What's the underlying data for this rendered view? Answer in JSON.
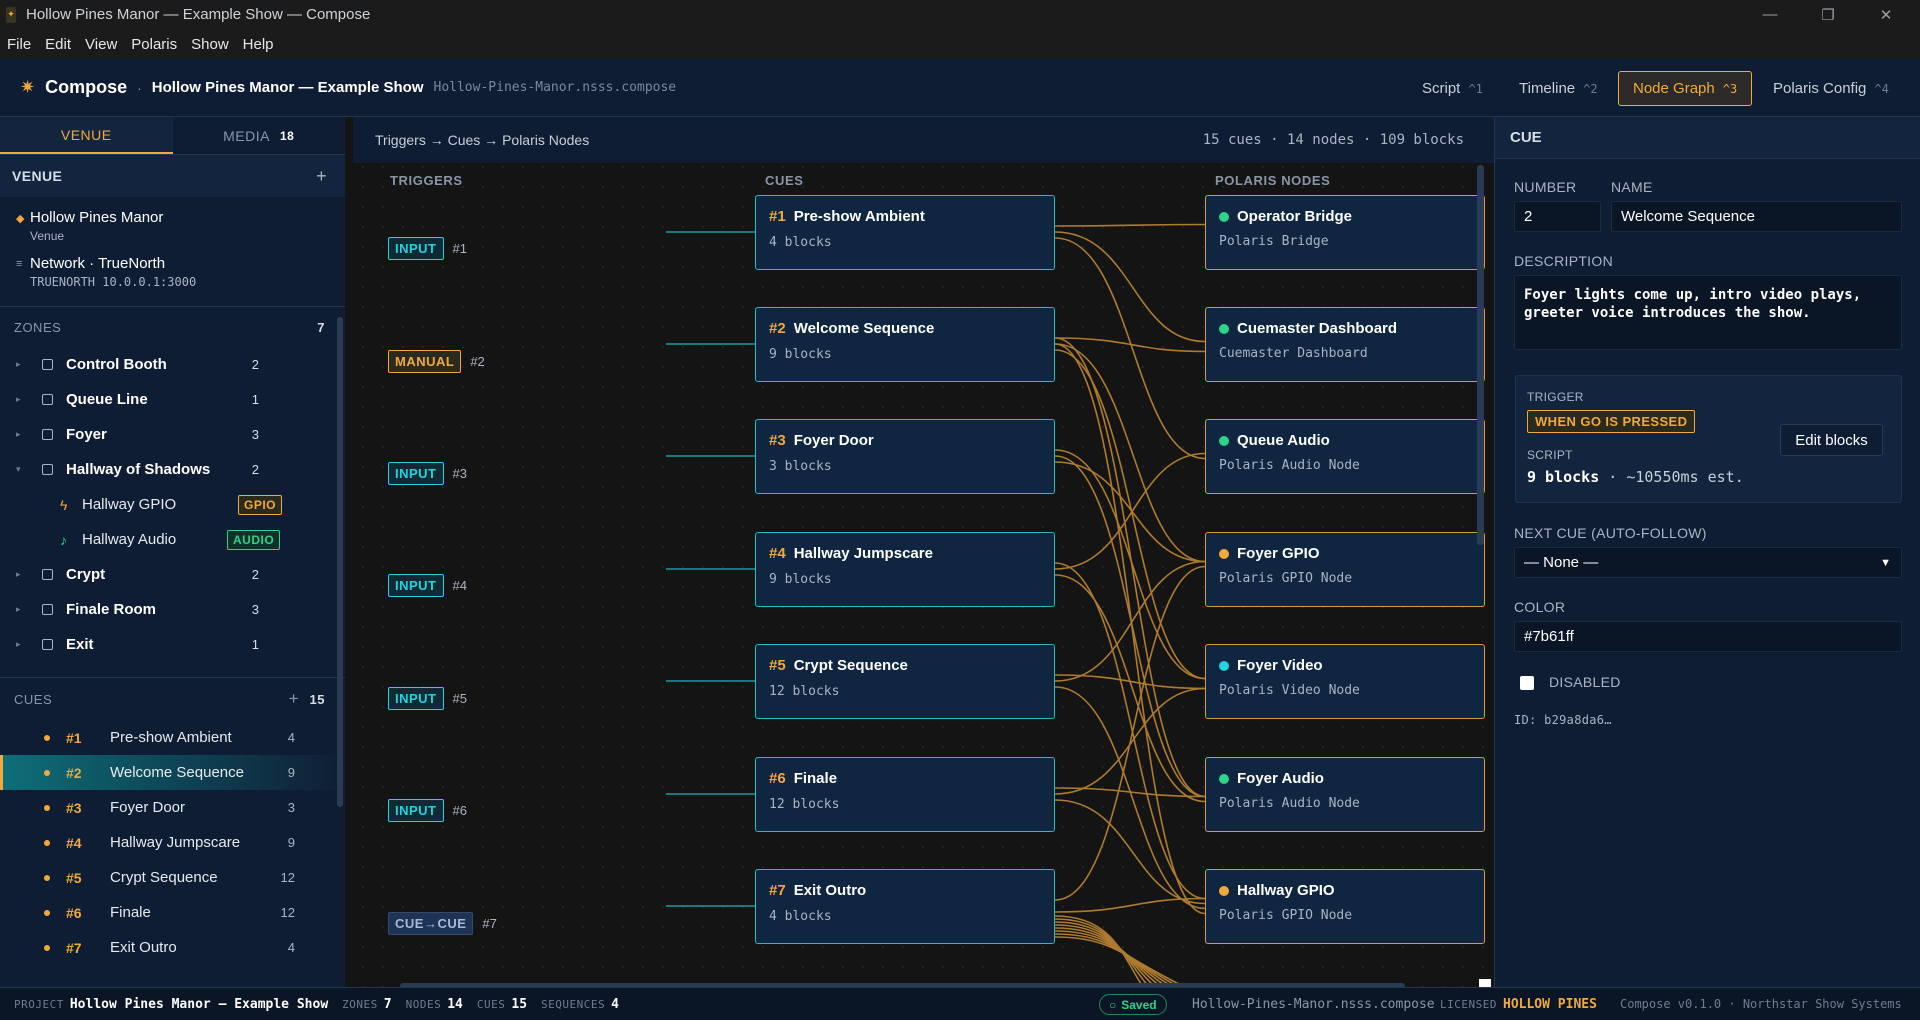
{
  "window": {
    "title": "Hollow Pines Manor — Example Show — Compose"
  },
  "menu": [
    "File",
    "Edit",
    "View",
    "Polaris",
    "Show",
    "Help"
  ],
  "appbar": {
    "brand": "Compose",
    "separator": "·",
    "show_name": "Hollow Pines Manor — Example Show",
    "file": "Hollow-Pines-Manor.nsss.compose"
  },
  "nav_tabs": [
    {
      "label": "Script",
      "key": "^1"
    },
    {
      "label": "Timeline",
      "key": "^2"
    },
    {
      "label": "Node Graph",
      "key": "^3"
    },
    {
      "label": "Polaris Config",
      "key": "^4"
    }
  ],
  "sidebar": {
    "tabs": [
      {
        "label": "VENUE"
      },
      {
        "label": "MEDIA",
        "badge": "18"
      }
    ],
    "venue_header": "VENUE",
    "venue_add": "+",
    "venue_items": [
      {
        "name": "Hollow Pines Manor",
        "sub": "Venue"
      },
      {
        "name": "Network · TrueNorth",
        "sub": "TRUENORTH 10.0.0.1:3000"
      }
    ],
    "zones_label": "ZONES",
    "zones_count": "7",
    "zones": [
      {
        "name": "Control Booth",
        "count": "2"
      },
      {
        "name": "Queue Line",
        "count": "1"
      },
      {
        "name": "Foyer",
        "count": "3"
      },
      {
        "name": "Hallway of Shadows",
        "count": "2"
      },
      {
        "name": "Crypt",
        "count": "2"
      },
      {
        "name": "Finale Room",
        "count": "3"
      },
      {
        "name": "Exit",
        "count": "1"
      }
    ],
    "zone_children": [
      {
        "name": "Hallway GPIO",
        "tag": "GPIO"
      },
      {
        "name": "Hallway Audio",
        "tag": "AUDIO"
      }
    ],
    "cues_label": "CUES",
    "cues_add": "+",
    "cues_count": "15",
    "cues": [
      {
        "num": "#1",
        "name": "Pre-show Ambient",
        "count": "4"
      },
      {
        "num": "#2",
        "name": "Welcome Sequence",
        "count": "9"
      },
      {
        "num": "#3",
        "name": "Foyer Door",
        "count": "3"
      },
      {
        "num": "#4",
        "name": "Hallway Jumpscare",
        "count": "9"
      },
      {
        "num": "#5",
        "name": "Crypt Sequence",
        "count": "12"
      },
      {
        "num": "#6",
        "name": "Finale",
        "count": "12"
      },
      {
        "num": "#7",
        "name": "Exit Outro",
        "count": "4"
      }
    ]
  },
  "canvas": {
    "breadcrumb": "Triggers → Cues → Polaris Nodes",
    "stats": "15 cues · 14 nodes · 109 blocks",
    "col_triggers": "TRIGGERS",
    "col_cues": "CUES",
    "col_nodes": "POLARIS NODES",
    "triggers": [
      {
        "type": "INPUT",
        "idx": "#1"
      },
      {
        "type": "MANUAL",
        "idx": "#2"
      },
      {
        "type": "INPUT",
        "idx": "#3"
      },
      {
        "type": "INPUT",
        "idx": "#4"
      },
      {
        "type": "INPUT",
        "idx": "#5"
      },
      {
        "type": "INPUT",
        "idx": "#6"
      },
      {
        "type": "CUE→CUE",
        "idx": "#7"
      }
    ],
    "cues": [
      {
        "num": "#1",
        "name": "Pre-show Ambient",
        "blocks": "4 blocks"
      },
      {
        "num": "#2",
        "name": "Welcome Sequence",
        "blocks": "9 blocks"
      },
      {
        "num": "#3",
        "name": "Foyer Door",
        "blocks": "3 blocks"
      },
      {
        "num": "#4",
        "name": "Hallway Jumpscare",
        "blocks": "9 blocks"
      },
      {
        "num": "#5",
        "name": "Crypt Sequence",
        "blocks": "12 blocks"
      },
      {
        "num": "#6",
        "name": "Finale",
        "blocks": "12 blocks"
      },
      {
        "num": "#7",
        "name": "Exit Outro",
        "blocks": "4 blocks"
      }
    ],
    "nodes": [
      {
        "name": "Operator Bridge",
        "type": "Polaris Bridge",
        "status": "#2fd28a"
      },
      {
        "name": "Cuemaster Dashboard",
        "type": "Cuemaster Dashboard",
        "status": "#2fd28a"
      },
      {
        "name": "Queue Audio",
        "type": "Polaris Audio Node",
        "status": "#2fd28a"
      },
      {
        "name": "Foyer GPIO",
        "type": "Polaris GPIO Node",
        "status": "#f2a93b"
      },
      {
        "name": "Foyer Video",
        "type": "Polaris Video Node",
        "status": "#22d3e0"
      },
      {
        "name": "Foyer Audio",
        "type": "Polaris Audio Node",
        "status": "#2fd28a"
      },
      {
        "name": "Hallway GPIO",
        "type": "Polaris GPIO Node",
        "status": "#f2a93b"
      }
    ]
  },
  "inspector": {
    "title": "CUE",
    "number_label": "NUMBER",
    "number_value": "2",
    "name_label": "NAME",
    "name_value": "Welcome Sequence",
    "description_label": "DESCRIPTION",
    "description_value": "Foyer lights come up, intro video plays, greeter voice introduces the show.",
    "trigger_label": "TRIGGER",
    "trigger_value": "WHEN GO IS PRESSED",
    "script_label": "SCRIPT",
    "script_blocks": "9 blocks",
    "script_est": "· ~10550ms est.",
    "edit_blocks": "Edit blocks",
    "next_cue_label": "NEXT CUE (AUTO-FOLLOW)",
    "next_cue_value": "— None —",
    "color_label": "COLOR",
    "color_value": "#7b61ff",
    "disabled_label": "DISABLED",
    "id_text": "ID: b29a8da6…"
  },
  "statusbar": {
    "project_label": "PROJECT",
    "project_value": "Hollow Pines Manor — Example Show",
    "zones_label": "ZONES",
    "zones_value": "7",
    "nodes_label": "NODES",
    "nodes_value": "14",
    "cues_label": "CUES",
    "cues_value": "15",
    "sequences_label": "SEQUENCES",
    "sequences_value": "4",
    "saved": "Saved",
    "file": "Hollow-Pines-Manor.nsss.compose",
    "licensed_label": "LICENSED",
    "licensed_value": "HOLLOW PINES",
    "version": "Compose v0.1.0 · Northstar Show Systems"
  },
  "colors": {
    "accent": "#f2a93b",
    "teal": "#1fbfc6",
    "bg": "#0f1d34",
    "wire": "#d99a3a"
  }
}
